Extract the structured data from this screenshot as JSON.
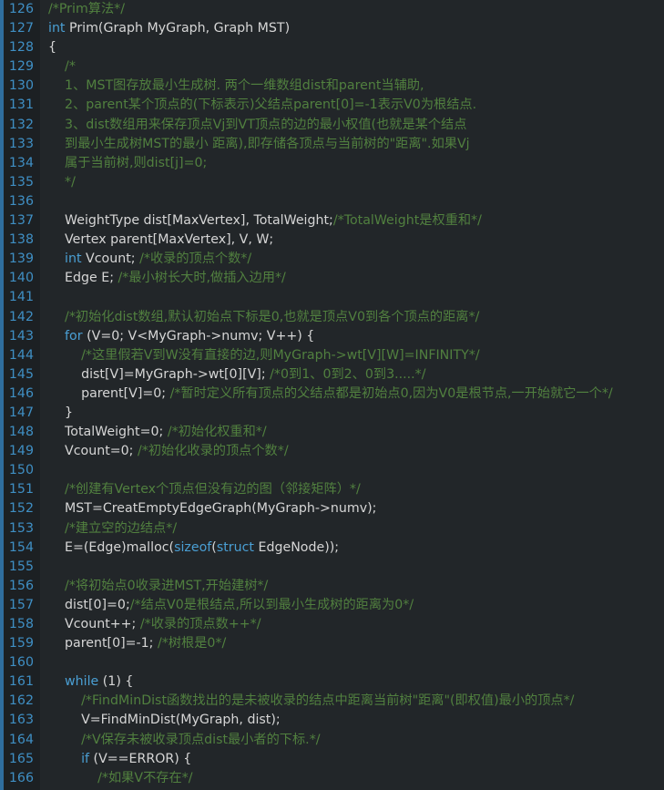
{
  "editor": {
    "name": "code-editor",
    "language": "C",
    "theme": "dark",
    "colors": {
      "background": "#222629",
      "gutter_background": "#1c2023",
      "line_number": "#3f8fc4",
      "comment": "#51803f",
      "keyword": "#4a9fd4",
      "plain_text": "#d6d6d6",
      "edge_stripe": "#2f6e9e"
    },
    "first_line_number": 126,
    "last_line_number": 166
  },
  "lines": [
    {
      "n": "126",
      "tokens": [
        {
          "t": "cmt",
          "s": "/*Prim算法*/"
        }
      ]
    },
    {
      "n": "127",
      "tokens": [
        {
          "t": "kw",
          "s": "int"
        },
        {
          "t": "txt",
          "s": " Prim(Graph MyGraph, Graph MST)"
        }
      ]
    },
    {
      "n": "128",
      "tokens": [
        {
          "t": "txt",
          "s": "{"
        }
      ]
    },
    {
      "n": "129",
      "tokens": [
        {
          "t": "cmt",
          "s": "    /*"
        }
      ]
    },
    {
      "n": "130",
      "tokens": [
        {
          "t": "cmt",
          "s": "    1、MST图存放最小生成树. 两个一维数组dist和parent当辅助,"
        }
      ]
    },
    {
      "n": "131",
      "tokens": [
        {
          "t": "cmt",
          "s": "    2、parent某个顶点的(下标表示)父结点parent[0]=-1表示V0为根结点."
        }
      ]
    },
    {
      "n": "132",
      "tokens": [
        {
          "t": "cmt",
          "s": "    3、dist数组用来保存顶点Vj到VT顶点的边的最小权值(也就是某个结点"
        }
      ]
    },
    {
      "n": "133",
      "tokens": [
        {
          "t": "cmt",
          "s": "    到最小生成树MST的最小 距离),即存储各顶点与当前树的\"距离\".如果Vj"
        }
      ]
    },
    {
      "n": "134",
      "tokens": [
        {
          "t": "cmt",
          "s": "    属于当前树,则dist[j]=0;"
        }
      ]
    },
    {
      "n": "135",
      "tokens": [
        {
          "t": "cmt",
          "s": "    */"
        }
      ]
    },
    {
      "n": "136",
      "tokens": []
    },
    {
      "n": "137",
      "tokens": [
        {
          "t": "txt",
          "s": "    WeightType dist[MaxVertex], TotalWeight;"
        },
        {
          "t": "cmt",
          "s": "/*TotalWeight是权重和*/"
        }
      ]
    },
    {
      "n": "138",
      "tokens": [
        {
          "t": "txt",
          "s": "    Vertex parent[MaxVertex], V, W;"
        }
      ]
    },
    {
      "n": "139",
      "tokens": [
        {
          "t": "txt",
          "s": "    "
        },
        {
          "t": "kw",
          "s": "int"
        },
        {
          "t": "txt",
          "s": " Vcount; "
        },
        {
          "t": "cmt",
          "s": "/*收录的顶点个数*/"
        }
      ]
    },
    {
      "n": "140",
      "tokens": [
        {
          "t": "txt",
          "s": "    Edge E; "
        },
        {
          "t": "cmt",
          "s": "/*最小树长大时,做插入边用*/"
        }
      ]
    },
    {
      "n": "141",
      "tokens": []
    },
    {
      "n": "142",
      "tokens": [
        {
          "t": "cmt",
          "s": "    /*初始化dist数组,默认初始点下标是0,也就是顶点V0到各个顶点的距离*/"
        }
      ]
    },
    {
      "n": "143",
      "tokens": [
        {
          "t": "txt",
          "s": "    "
        },
        {
          "t": "kw",
          "s": "for"
        },
        {
          "t": "txt",
          "s": " (V=0; V<MyGraph->numv; V++) {"
        }
      ]
    },
    {
      "n": "144",
      "tokens": [
        {
          "t": "cmt",
          "s": "        /*这里假若V到W没有直接的边,则MyGraph->wt[V][W]=INFINITY*/"
        }
      ]
    },
    {
      "n": "145",
      "tokens": [
        {
          "t": "txt",
          "s": "        dist[V]=MyGraph->wt[0][V]; "
        },
        {
          "t": "cmt",
          "s": "/*0到1、0到2、0到3.....*/"
        }
      ]
    },
    {
      "n": "146",
      "tokens": [
        {
          "t": "txt",
          "s": "        parent[V]=0; "
        },
        {
          "t": "cmt",
          "s": "/*暂时定义所有顶点的父结点都是初始点0,因为V0是根节点,一开始就它一个*/"
        }
      ]
    },
    {
      "n": "147",
      "tokens": [
        {
          "t": "txt",
          "s": "    }"
        }
      ]
    },
    {
      "n": "148",
      "tokens": [
        {
          "t": "txt",
          "s": "    TotalWeight=0; "
        },
        {
          "t": "cmt",
          "s": "/*初始化权重和*/"
        }
      ]
    },
    {
      "n": "149",
      "tokens": [
        {
          "t": "txt",
          "s": "    Vcount=0; "
        },
        {
          "t": "cmt",
          "s": "/*初始化收录的顶点个数*/"
        }
      ]
    },
    {
      "n": "150",
      "tokens": []
    },
    {
      "n": "151",
      "tokens": [
        {
          "t": "cmt",
          "s": "    /*创建有Vertex个顶点但没有边的图（邻接矩阵）*/"
        }
      ]
    },
    {
      "n": "152",
      "tokens": [
        {
          "t": "txt",
          "s": "    MST=CreatEmptyEdgeGraph(MyGraph->numv);"
        }
      ]
    },
    {
      "n": "153",
      "tokens": [
        {
          "t": "cmt",
          "s": "    /*建立空的边结点*/"
        }
      ]
    },
    {
      "n": "154",
      "tokens": [
        {
          "t": "txt",
          "s": "    E=(Edge)malloc("
        },
        {
          "t": "kw",
          "s": "sizeof"
        },
        {
          "t": "txt",
          "s": "("
        },
        {
          "t": "kw",
          "s": "struct"
        },
        {
          "t": "txt",
          "s": " EdgeNode));"
        }
      ]
    },
    {
      "n": "155",
      "tokens": []
    },
    {
      "n": "156",
      "tokens": [
        {
          "t": "cmt",
          "s": "    /*将初始点0收录进MST,开始建树*/"
        }
      ]
    },
    {
      "n": "157",
      "tokens": [
        {
          "t": "txt",
          "s": "    dist[0]=0;"
        },
        {
          "t": "cmt",
          "s": "/*结点V0是根结点,所以到最小生成树的距离为0*/"
        }
      ]
    },
    {
      "n": "158",
      "tokens": [
        {
          "t": "txt",
          "s": "    Vcount++; "
        },
        {
          "t": "cmt",
          "s": "/*收录的顶点数++*/"
        }
      ]
    },
    {
      "n": "159",
      "tokens": [
        {
          "t": "txt",
          "s": "    parent[0]=-1; "
        },
        {
          "t": "cmt",
          "s": "/*树根是0*/"
        }
      ]
    },
    {
      "n": "160",
      "tokens": []
    },
    {
      "n": "161",
      "tokens": [
        {
          "t": "txt",
          "s": "    "
        },
        {
          "t": "kw",
          "s": "while"
        },
        {
          "t": "txt",
          "s": " (1) {"
        }
      ]
    },
    {
      "n": "162",
      "tokens": [
        {
          "t": "cmt",
          "s": "        /*FindMinDist函数找出的是未被收录的结点中距离当前树\"距离\"(即权值)最小的顶点*/"
        }
      ]
    },
    {
      "n": "163",
      "tokens": [
        {
          "t": "txt",
          "s": "        V=FindMinDist(MyGraph, dist);"
        }
      ]
    },
    {
      "n": "164",
      "tokens": [
        {
          "t": "cmt",
          "s": "        /*V保存未被收录顶点dist最小者的下标.*/"
        }
      ]
    },
    {
      "n": "165",
      "tokens": [
        {
          "t": "txt",
          "s": "        "
        },
        {
          "t": "kw",
          "s": "if"
        },
        {
          "t": "txt",
          "s": " (V==ERROR) {"
        }
      ]
    },
    {
      "n": "166",
      "tokens": [
        {
          "t": "cmt",
          "s": "            /*如果V不存在*/"
        }
      ]
    }
  ]
}
